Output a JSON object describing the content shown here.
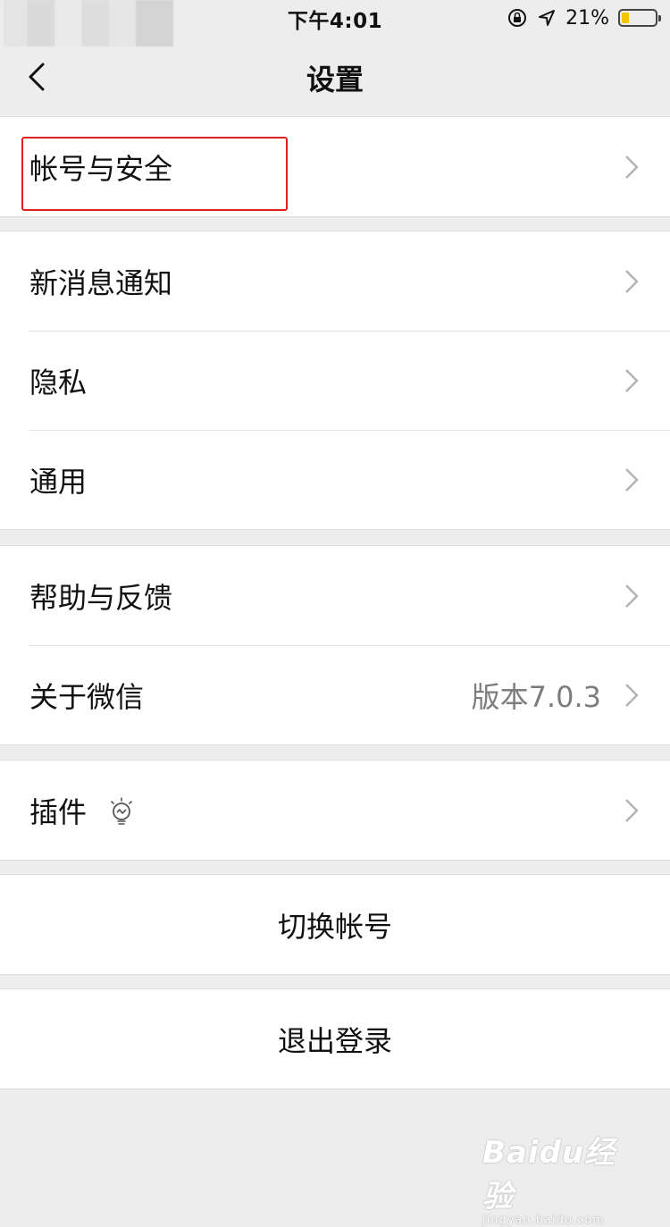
{
  "status_bar": {
    "time": "下午4:01",
    "battery_percent": "21%",
    "battery_level": 0.21,
    "battery_color": "#f3c400"
  },
  "nav": {
    "title": "设置"
  },
  "groups": [
    {
      "items": [
        {
          "label": "帐号与安全"
        }
      ]
    },
    {
      "items": [
        {
          "label": "新消息通知"
        },
        {
          "label": "隐私"
        },
        {
          "label": "通用"
        }
      ]
    },
    {
      "items": [
        {
          "label": "帮助与反馈"
        },
        {
          "label": "关于微信",
          "value": "版本7.0.3"
        }
      ]
    },
    {
      "items": [
        {
          "label": "插件",
          "icon": "lightbulb-icon"
        }
      ]
    }
  ],
  "actions": {
    "switch_account": "切换帐号",
    "logout": "退出登录"
  },
  "highlight_color": "#e02020",
  "watermark": {
    "main": "Baidu经验",
    "sub": "jingyan.baidu.com"
  }
}
